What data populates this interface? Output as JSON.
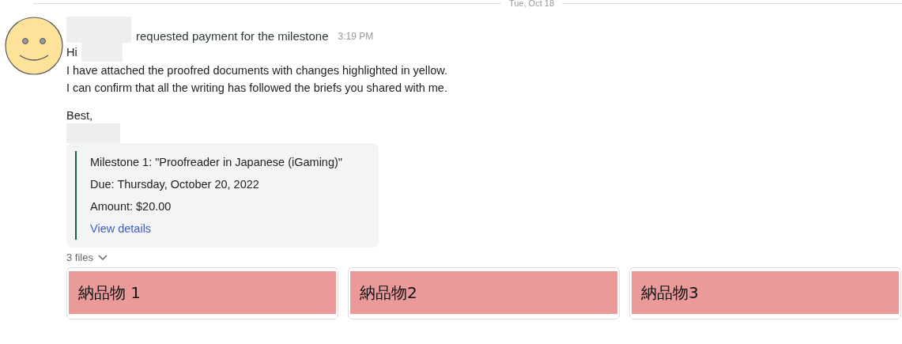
{
  "date_divider": "Tue, Oct 18",
  "message": {
    "header": "requested payment for the milestone",
    "time": "3:19 PM",
    "greeting": "Hi",
    "body": [
      "I have attached the proofred documents with changes highlighted in yellow.",
      "I can confirm that all the writing has followed the briefs you shared with me."
    ],
    "signoff": "Best,"
  },
  "milestone": {
    "title": "Milestone 1: \"Proofreader in Japanese (iGaming)\"",
    "due": "Due: Thursday, October 20, 2022",
    "amount": "Amount: $20.00",
    "link": "View details"
  },
  "files": {
    "count": "3 files",
    "expanded": true,
    "items": [
      "納品物 1",
      "納品物2",
      "納品物3"
    ]
  }
}
